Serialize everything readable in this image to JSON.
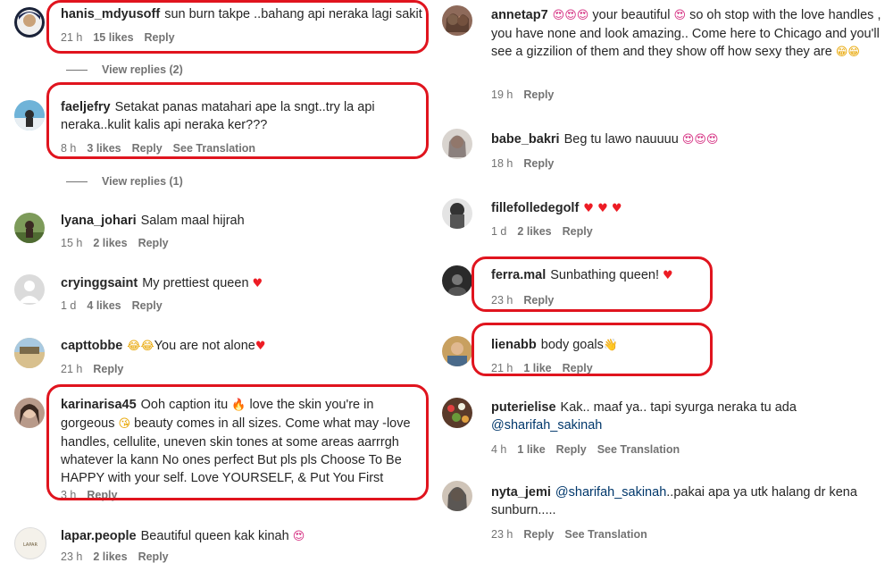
{
  "colors": {
    "highlight": "#e0141e",
    "meta": "#737373",
    "mention": "#00376b"
  },
  "left": [
    {
      "user": "hanis_mdyusoff",
      "text": "sun burn takpe ..bahang api neraka lagi sakit",
      "time": "21 h",
      "likes": "15 likes",
      "reply": "Reply",
      "translate": ""
    },
    {
      "view_replies": "View replies (2)"
    },
    {
      "user": "faeljefry",
      "text": "Setakat panas matahari ape la sngt..try la api neraka..kulit kalis api neraka ker???",
      "time": "8 h",
      "likes": "3 likes",
      "reply": "Reply",
      "translate": "See Translation"
    },
    {
      "view_replies": "View replies (1)"
    },
    {
      "user": "lyana_johari",
      "text": "Salam maal hijrah",
      "time": "15 h",
      "likes": "2 likes",
      "reply": "Reply"
    },
    {
      "user": "cryinggsaint",
      "text": "My prettiest queen",
      "emoji_after": "heart-icon",
      "time": "1 d",
      "likes": "4 likes",
      "reply": "Reply"
    },
    {
      "user": "capttobbe",
      "text": "You are not alone",
      "time": "21 h",
      "likes": "",
      "reply": "Reply"
    },
    {
      "user": "karinarisa45",
      "text_parts": [
        "Ooh caption itu",
        "love the skin you're in gorgeous",
        "beauty comes in all sizes. Come what may -love handles, cellulite, uneven skin tones at some areas aarrrgh whatever la kann No ones perfect But pls pls Choose To Be HAPPY with your self. Love YOURSELF, & Put You First"
      ],
      "time": "3 h",
      "likes": "",
      "reply": "Reply"
    },
    {
      "user": "lapar.people",
      "text": "Beautiful queen kak kinah",
      "time": "23 h",
      "likes": "2 likes",
      "reply": "Reply"
    }
  ],
  "right": [
    {
      "user": "annetap7",
      "text_parts": [
        "your beautiful",
        "so oh stop with the love handles , you have none and look amazing.. Come here to Chicago and you'll see a gizzilion of them and they show off how sexy they are"
      ],
      "time": "19 h",
      "reply": "Reply"
    },
    {
      "user": "babe_bakri",
      "text": "Beg tu lawo nauuuu",
      "time": "18 h",
      "reply": "Reply"
    },
    {
      "user": "fillefolledegolf",
      "text": "",
      "time": "1 d",
      "likes": "2 likes",
      "reply": "Reply"
    },
    {
      "user": "ferra.mal",
      "text": "Sunbathing queen!",
      "time": "23 h",
      "reply": "Reply"
    },
    {
      "user": "lienabb",
      "text": "body goals",
      "time": "21 h",
      "likes": "1 like",
      "reply": "Reply"
    },
    {
      "user": "puterielise",
      "text": "Kak.. maaf ya.. tapi syurga neraka tu ada",
      "mention": "@sharifah_sakinah",
      "time": "4 h",
      "likes": "1 like",
      "reply": "Reply",
      "translate": "See Translation"
    },
    {
      "user": "nyta_jemi",
      "mention": "@sharifah_sakinah",
      "text": "..pakai apa ya utk halang dr kena sunburn.....",
      "time": "23 h",
      "reply": "Reply",
      "translate": "See Translation"
    }
  ]
}
